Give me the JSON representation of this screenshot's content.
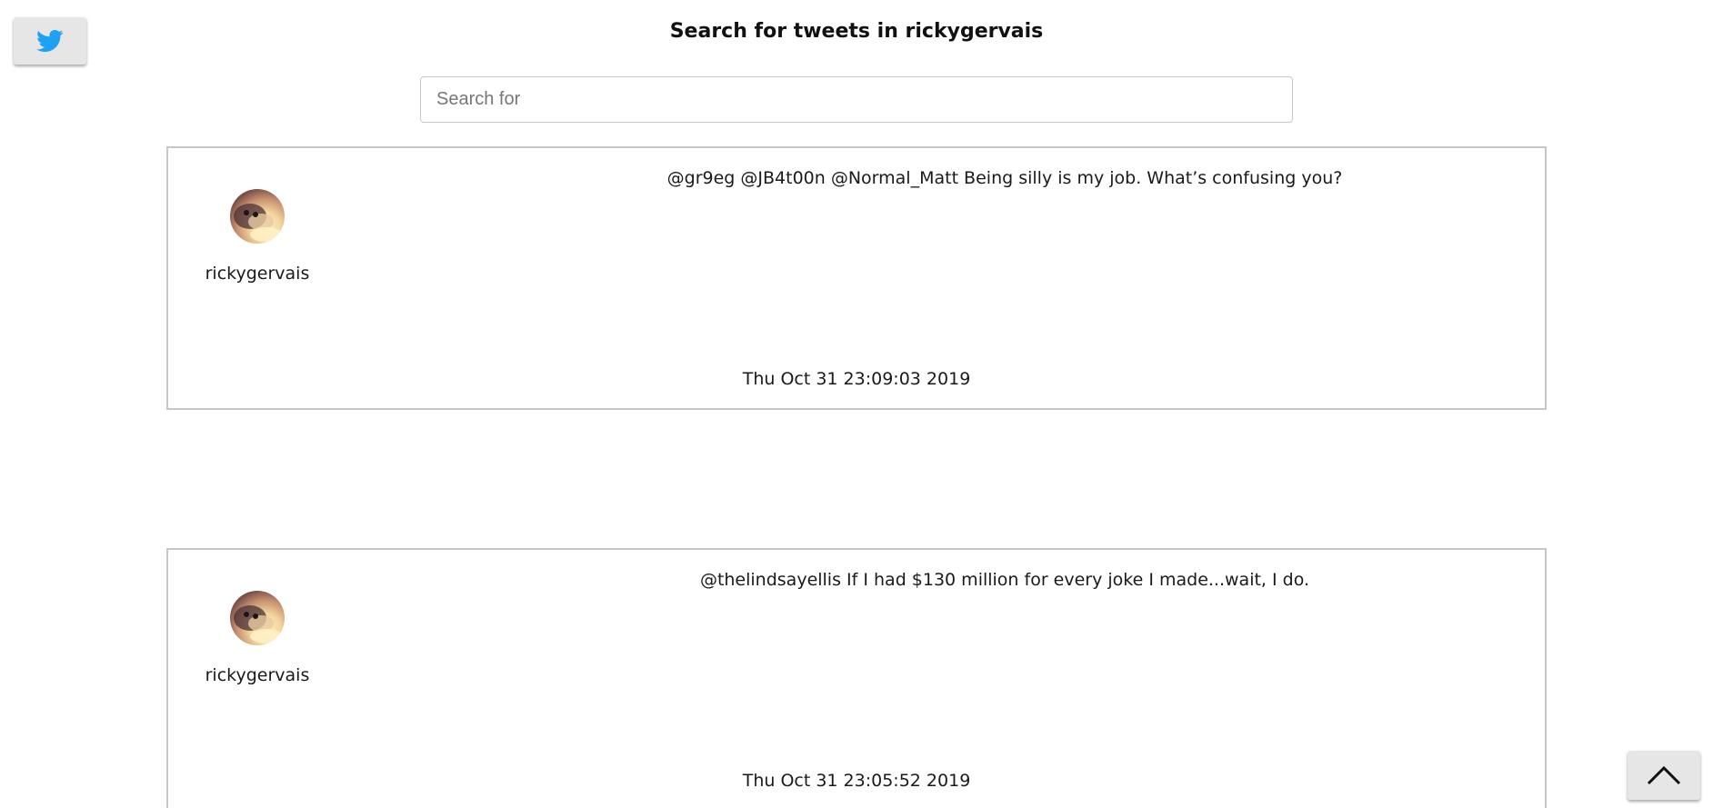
{
  "header": {
    "title": "Search for tweets in rickygervais",
    "twitter_icon": "twitter-bird-icon",
    "twitter_color": "#1da1f2"
  },
  "search": {
    "placeholder": "Search for",
    "value": ""
  },
  "tweets": [
    {
      "username": "rickygervais",
      "text": "@gr9eg @JB4t00n @Normal_Matt Being silly is my job. What’s confusing you?",
      "timestamp": "Thu Oct 31 23:09:03 2019"
    },
    {
      "username": "rickygervais",
      "text": "@thelindsayellis If I had $130 million for every joke I made...wait, I do.",
      "timestamp": "Thu Oct 31 23:05:52 2019"
    }
  ],
  "scroll_top": {
    "icon": "chevron-up-icon"
  }
}
